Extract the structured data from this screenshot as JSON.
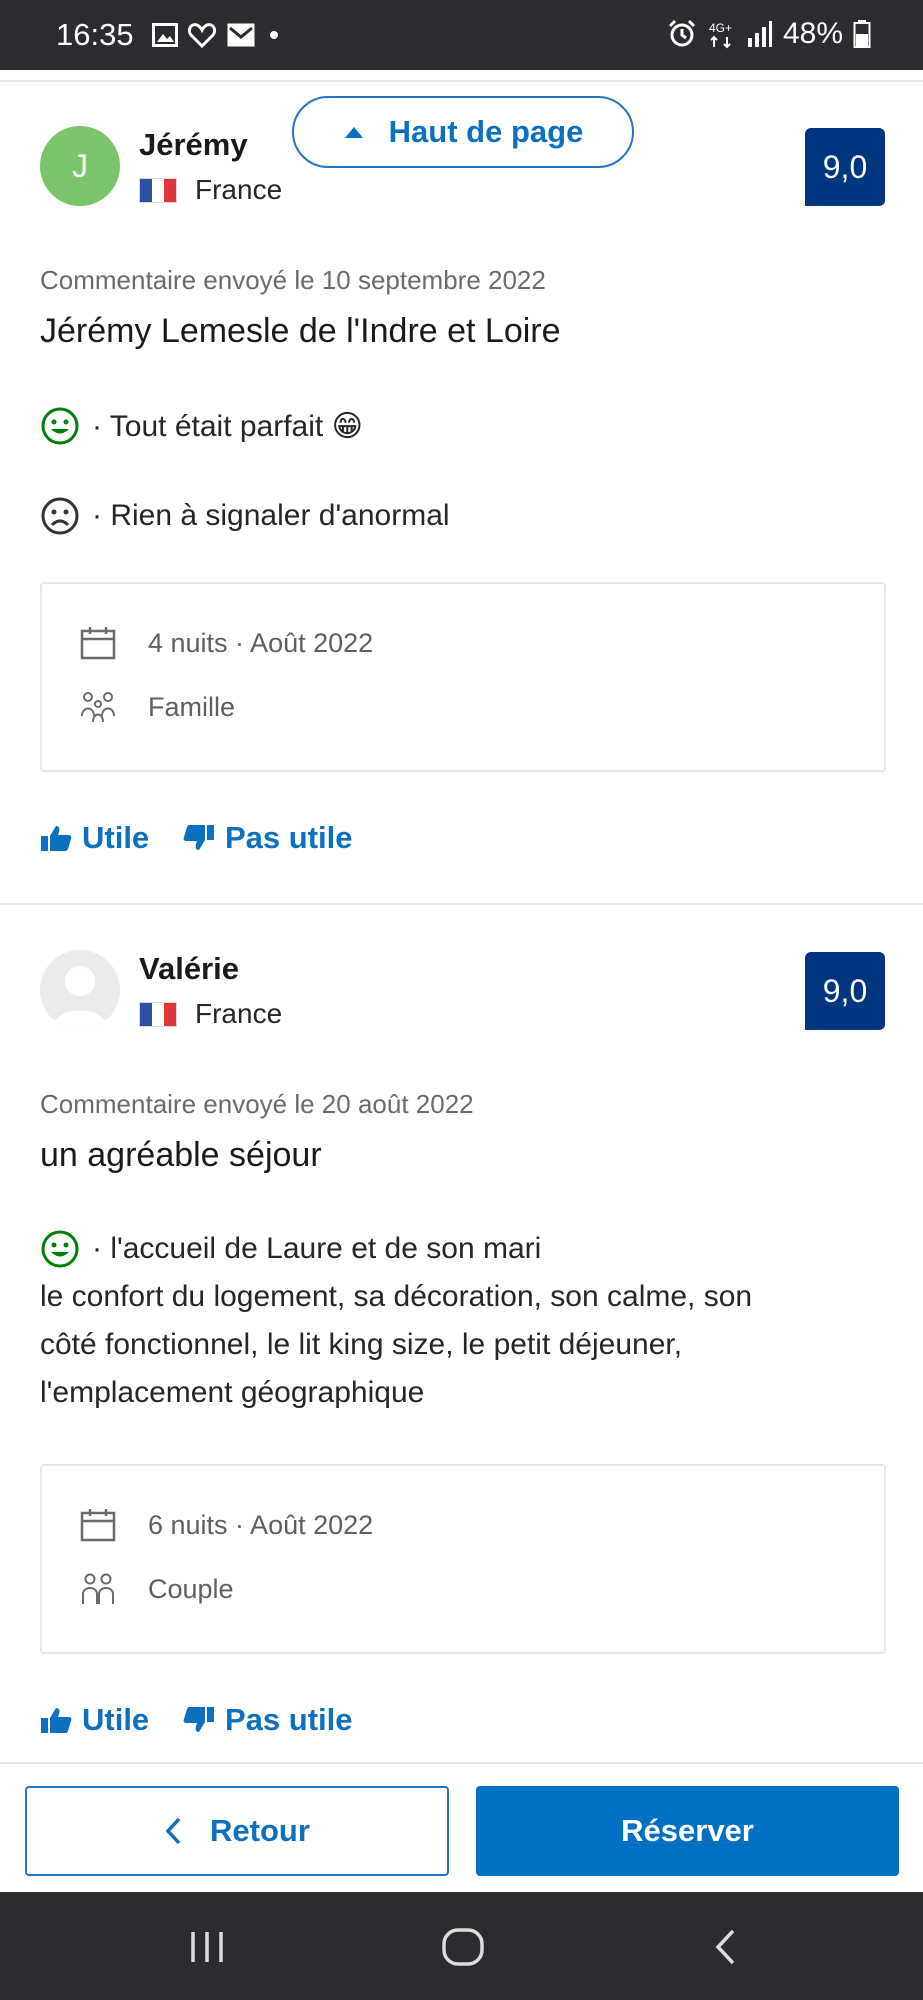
{
  "status_bar": {
    "time": "16:35",
    "battery": "48%",
    "network": "4G+",
    "icons_left": [
      "image-icon",
      "heart-outline-icon",
      "mail-icon",
      "dot-icon"
    ],
    "icons_right": [
      "alarm-icon",
      "network-4g-icon",
      "signal-icon",
      "battery-icon"
    ]
  },
  "top_page_button": {
    "label": "Haut de page"
  },
  "reviews": [
    {
      "avatar_initial": "J",
      "avatar_color": "#7cc46b",
      "name": "Jérémy",
      "country": "France",
      "score": "9,0",
      "date": "Commentaire envoyé le 10 septembre 2022",
      "title": "Jérémy Lemesle de l'Indre et Loire",
      "positive": "· Tout était parfait 😁",
      "negative": "· Rien à signaler d'anormal",
      "stay": "4 nuits · Août 2022",
      "traveler": "Famille",
      "helpful": "Utile",
      "not_helpful": "Pas utile"
    },
    {
      "avatar_initial": "",
      "avatar_color": "#ebebeb",
      "name": "Valérie",
      "country": "France",
      "score": "9,0",
      "date": "Commentaire envoyé le 20 août 2022",
      "title": "un agréable séjour",
      "positive_lines": [
        "· l'accueil de Laure et de son mari",
        "le confort du logement, sa décoration, son calme, son",
        "côté fonctionnel, le lit king size, le petit déjeuner,",
        "l'emplacement géographique"
      ],
      "stay": "6 nuits · Août 2022",
      "traveler": "Couple",
      "helpful": "Utile",
      "not_helpful": "Pas utile"
    }
  ],
  "footer": {
    "back_label": "Retour",
    "book_label": "Réserver"
  },
  "nav_bar": {
    "buttons": [
      "recent-apps-icon",
      "home-icon",
      "back-icon"
    ]
  },
  "colors": {
    "brand_blue": "#003580",
    "link_blue": "#0c6fbf",
    "button_blue": "#0071c2",
    "positive_green": "#008009"
  }
}
